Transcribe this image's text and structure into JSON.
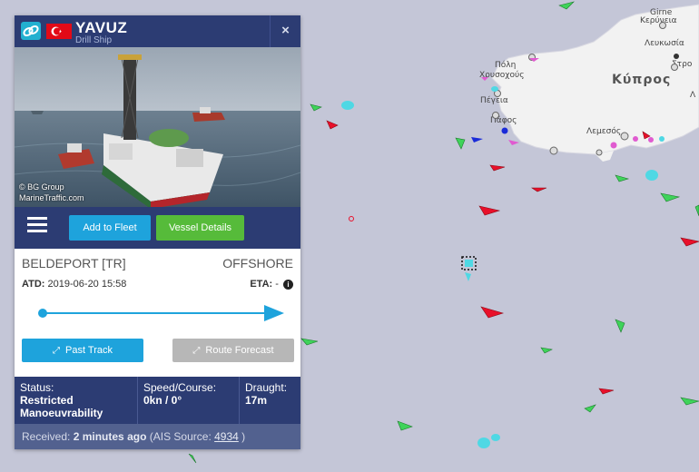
{
  "map": {
    "places": {
      "girne": "Girne",
      "keryneia": "Κερύνεια",
      "lefkosia": "Λευκωσία",
      "polis_tr": "Πόλη",
      "polis_chrysochous": "Χρυσοχούς",
      "stro": "Στρο",
      "kypros": "Κύπρος",
      "pegeia": "Πέγεια",
      "pafos": "Πάφος",
      "lemesos": "Λεμεσός",
      "lambda": "Λ"
    }
  },
  "panel": {
    "vessel_name": "YAVUZ",
    "vessel_type": "Drill Ship",
    "close_label": "×",
    "photo_credit_1": "© BG Group",
    "photo_credit_2": "MarineTraffic.com",
    "add_fleet_label": "Add to Fleet",
    "vessel_details_label": "Vessel Details",
    "departure_port": "BELDEPORT [TR]",
    "destination": "OFFSHORE",
    "atd_label": "ATD:",
    "atd_value": "2019-06-20 15:58",
    "eta_label": "ETA:",
    "eta_value": "-",
    "past_track_label": "Past Track",
    "route_forecast_label": "Route Forecast",
    "status_label": "Status:",
    "status_value": "Restricted Manoeuvrability",
    "speed_label": "Speed/Course:",
    "speed_value": "0kn / 0°",
    "draught_label": "Draught:",
    "draught_value": "17m",
    "received_label": "Received:",
    "received_value": "2 minutes ago",
    "ais_source_label": "(AIS Source:",
    "ais_source_value": "4934",
    "ais_source_close": ")"
  },
  "colors": {
    "header_bg": "#2c3c73",
    "accent_blue": "#1ea3dc",
    "accent_green": "#56bb3a",
    "sea": "#c4c6d7",
    "land": "#f2f2f2",
    "vessel_red": "#e8102a",
    "vessel_green": "#3fd35a"
  }
}
